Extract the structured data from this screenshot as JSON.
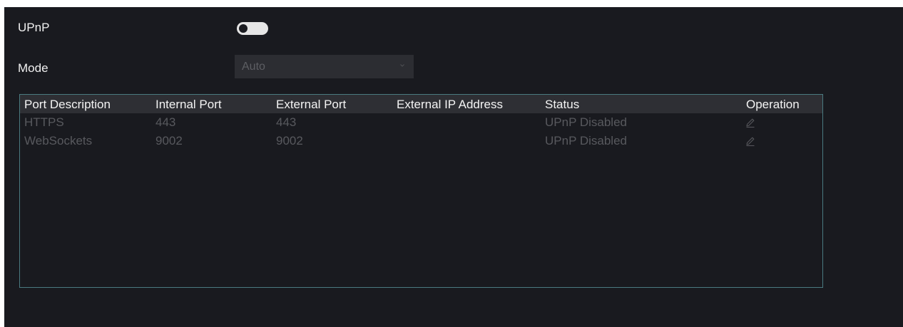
{
  "upnp": {
    "label": "UPnP",
    "enabled": false
  },
  "mode": {
    "label": "Mode",
    "value": "Auto",
    "disabled": true
  },
  "table": {
    "columns": [
      "Port Description",
      "Internal Port",
      "External Port",
      "External IP Address",
      "Status",
      "Operation"
    ],
    "rows": [
      {
        "description": "HTTPS",
        "internal_port": "443",
        "external_port": "443",
        "external_ip": "",
        "status": "UPnP Disabled",
        "operation_icon": "edit-icon"
      },
      {
        "description": "WebSockets",
        "internal_port": "9002",
        "external_port": "9002",
        "external_ip": "",
        "status": "UPnP Disabled",
        "operation_icon": "edit-icon"
      }
    ]
  },
  "colors": {
    "background": "#191a1f",
    "table_border": "#4a7a80",
    "header_bg": "#2e2f34",
    "disabled_text": "#58595e",
    "toggle_off": "#e6e6e6"
  }
}
